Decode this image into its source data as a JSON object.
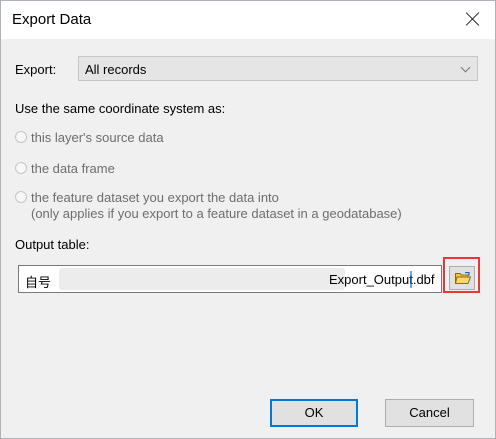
{
  "window": {
    "title": "Export Data"
  },
  "export": {
    "label": "Export:",
    "selected": "All records"
  },
  "coordinate": {
    "heading": "Use the same coordinate system as:",
    "options": [
      {
        "label": "this layer's source data",
        "enabled": false,
        "selected": false
      },
      {
        "label": "the data frame",
        "enabled": false,
        "selected": false
      },
      {
        "label": "the feature dataset you export the data into",
        "sublabel": "(only applies if you export to a feature dataset in a geodatabase)",
        "enabled": false,
        "selected": false
      }
    ]
  },
  "output": {
    "label": "Output table:",
    "value_prefix": "自号",
    "value_suffix": "Export_Output.dbf"
  },
  "buttons": {
    "ok": "OK",
    "cancel": "Cancel"
  },
  "icons": {
    "close": "close-icon",
    "browse": "folder-open-icon",
    "dropdown": "chevron-down-icon"
  },
  "colors": {
    "highlight": "#e53935",
    "focus": "#0078d7"
  }
}
